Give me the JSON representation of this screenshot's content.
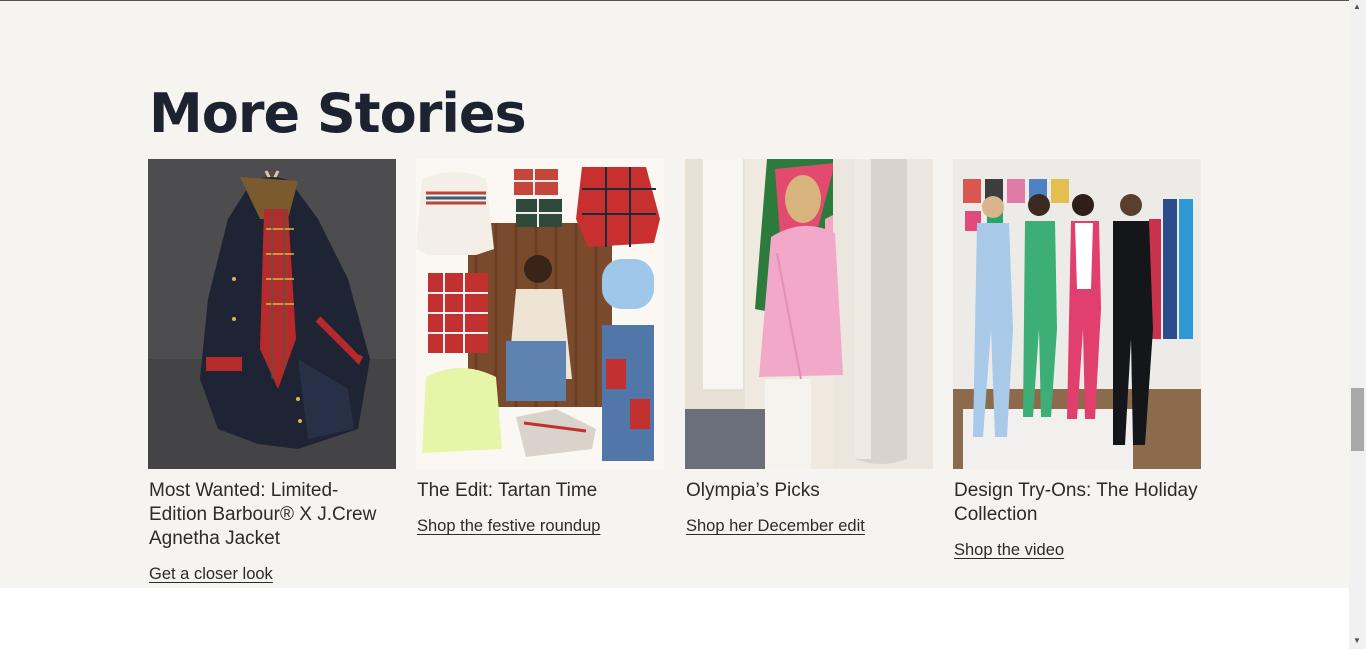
{
  "section": {
    "heading": "More Stories",
    "cards": [
      {
        "title": "Most Wanted: Limited-Edition Barbour® X J.Crew Agnetha Jacket",
        "link": "Get a closer look",
        "image_icon": "jacket-image"
      },
      {
        "title": "The Edit: Tartan Time",
        "link": "Shop the festive roundup",
        "image_icon": "tartan-collage-image"
      },
      {
        "title": "Olympia’s Picks",
        "link": "Shop her December edit",
        "image_icon": "pink-coat-image"
      },
      {
        "title": "Design Try-Ons: The Holiday Collection",
        "link": "Shop the video",
        "image_icon": "group-suits-image"
      }
    ]
  },
  "colors": {
    "section_background": "#f6f4f0",
    "heading": "#1d2230",
    "text": "#2b2b2b"
  }
}
